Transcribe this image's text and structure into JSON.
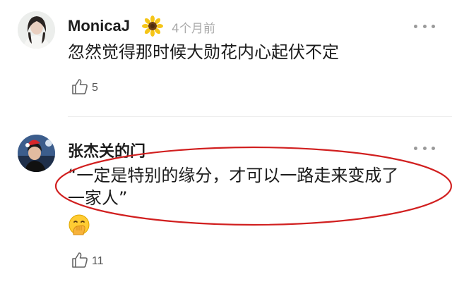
{
  "comments": [
    {
      "username": "MonicaJ",
      "time": "4个月前",
      "text": "忽然觉得那时候大勋花内心起伏不定",
      "likes": "5"
    },
    {
      "username": "张杰关的门",
      "text_line1": "“一定是特别的缘分，才可以一路走来变成了",
      "text_line2": "一家人”",
      "likes": "11"
    }
  ],
  "icons": {
    "badge": "sunflower-icon",
    "more": "more-dots-icon",
    "like": "thumbs-up-icon",
    "emoji": "hand-over-mouth-emoji"
  },
  "colors": {
    "annotation": "#d11f1f",
    "muted_text": "#aaaaaa"
  }
}
